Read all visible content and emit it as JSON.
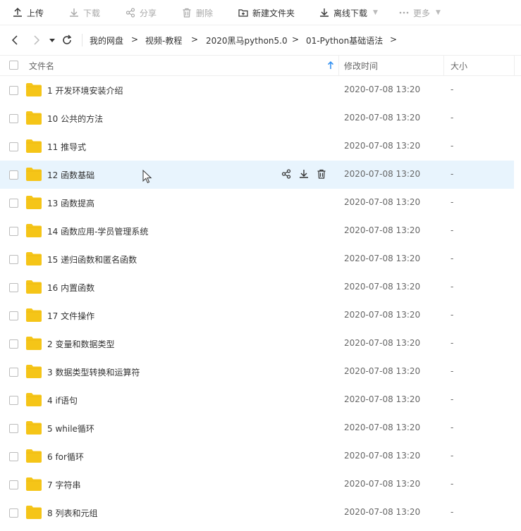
{
  "toolbar": {
    "upload": "上传",
    "download": "下载",
    "share": "分享",
    "delete": "删除",
    "new_folder": "新建文件夹",
    "offline_download": "离线下载",
    "more": "更多"
  },
  "nav": {
    "breadcrumbs": [
      "我的网盘",
      "视频-教程",
      "2020黑马python5.0",
      "01-Python基础语法"
    ],
    "separator": ">"
  },
  "columns": {
    "name": "文件名",
    "modified": "修改时间",
    "size": "大小"
  },
  "files": [
    {
      "name": "1 开发环境安装介绍",
      "modified": "2020-07-08 13:20",
      "size": "-"
    },
    {
      "name": "10 公共的方法",
      "modified": "2020-07-08 13:20",
      "size": "-"
    },
    {
      "name": "11 推导式",
      "modified": "2020-07-08 13:20",
      "size": "-"
    },
    {
      "name": "12 函数基础",
      "modified": "2020-07-08 13:20",
      "size": "-"
    },
    {
      "name": "13 函数提高",
      "modified": "2020-07-08 13:20",
      "size": "-"
    },
    {
      "name": "14 函数应用-学员管理系统",
      "modified": "2020-07-08 13:20",
      "size": "-"
    },
    {
      "name": "15 递归函数和匿名函数",
      "modified": "2020-07-08 13:20",
      "size": "-"
    },
    {
      "name": "16 内置函数",
      "modified": "2020-07-08 13:20",
      "size": "-"
    },
    {
      "name": "17 文件操作",
      "modified": "2020-07-08 13:20",
      "size": "-"
    },
    {
      "name": "2 变量和数据类型",
      "modified": "2020-07-08 13:20",
      "size": "-"
    },
    {
      "name": "3 数据类型转换和运算符",
      "modified": "2020-07-08 13:20",
      "size": "-"
    },
    {
      "name": "4 if语句",
      "modified": "2020-07-08 13:20",
      "size": "-"
    },
    {
      "name": "5 while循环",
      "modified": "2020-07-08 13:20",
      "size": "-"
    },
    {
      "name": "6 for循环",
      "modified": "2020-07-08 13:20",
      "size": "-"
    },
    {
      "name": "7 字符串",
      "modified": "2020-07-08 13:20",
      "size": "-"
    },
    {
      "name": "8 列表和元组",
      "modified": "2020-07-08 13:20",
      "size": "-"
    }
  ],
  "hovered_row": 3,
  "colors": {
    "folder": "#f5c518",
    "hover_row": "#e8f4fd",
    "sort_arrow": "#2b8cf0"
  }
}
